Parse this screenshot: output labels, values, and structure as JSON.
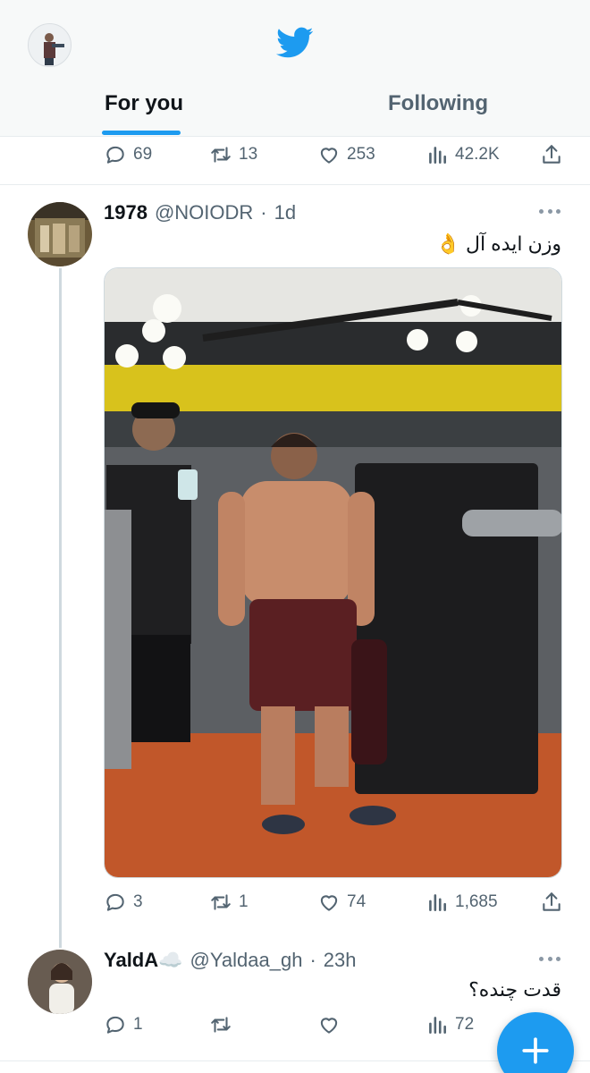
{
  "header": {
    "tabs": [
      {
        "label": "For you",
        "active": true
      },
      {
        "label": "Following",
        "active": false
      }
    ],
    "accent_color": "#1d9bf0"
  },
  "prev_tweet_actions": {
    "replies": "69",
    "retweets": "13",
    "likes": "253",
    "views": "42.2K"
  },
  "tweet1": {
    "name": "1978",
    "handle": "@NOIODR",
    "separator": "·",
    "time": "1d",
    "text": "وزن ایده آل 👌",
    "actions": {
      "replies": "3",
      "retweets": "1",
      "likes": "74",
      "views": "1,685"
    }
  },
  "tweet2": {
    "name": "YaldA☁️",
    "handle": "@Yaldaa_gh",
    "separator": "·",
    "time": "23h",
    "text": "قدت چنده؟",
    "actions": {
      "replies": "1",
      "retweets": "",
      "likes": "",
      "views": "72"
    }
  },
  "icons": {
    "header": [
      "profile-avatar",
      "twitter-bird-icon"
    ],
    "actions": [
      "reply-icon",
      "retweet-icon",
      "like-icon",
      "views-icon",
      "share-icon"
    ],
    "fab": "compose-plus-icon"
  }
}
